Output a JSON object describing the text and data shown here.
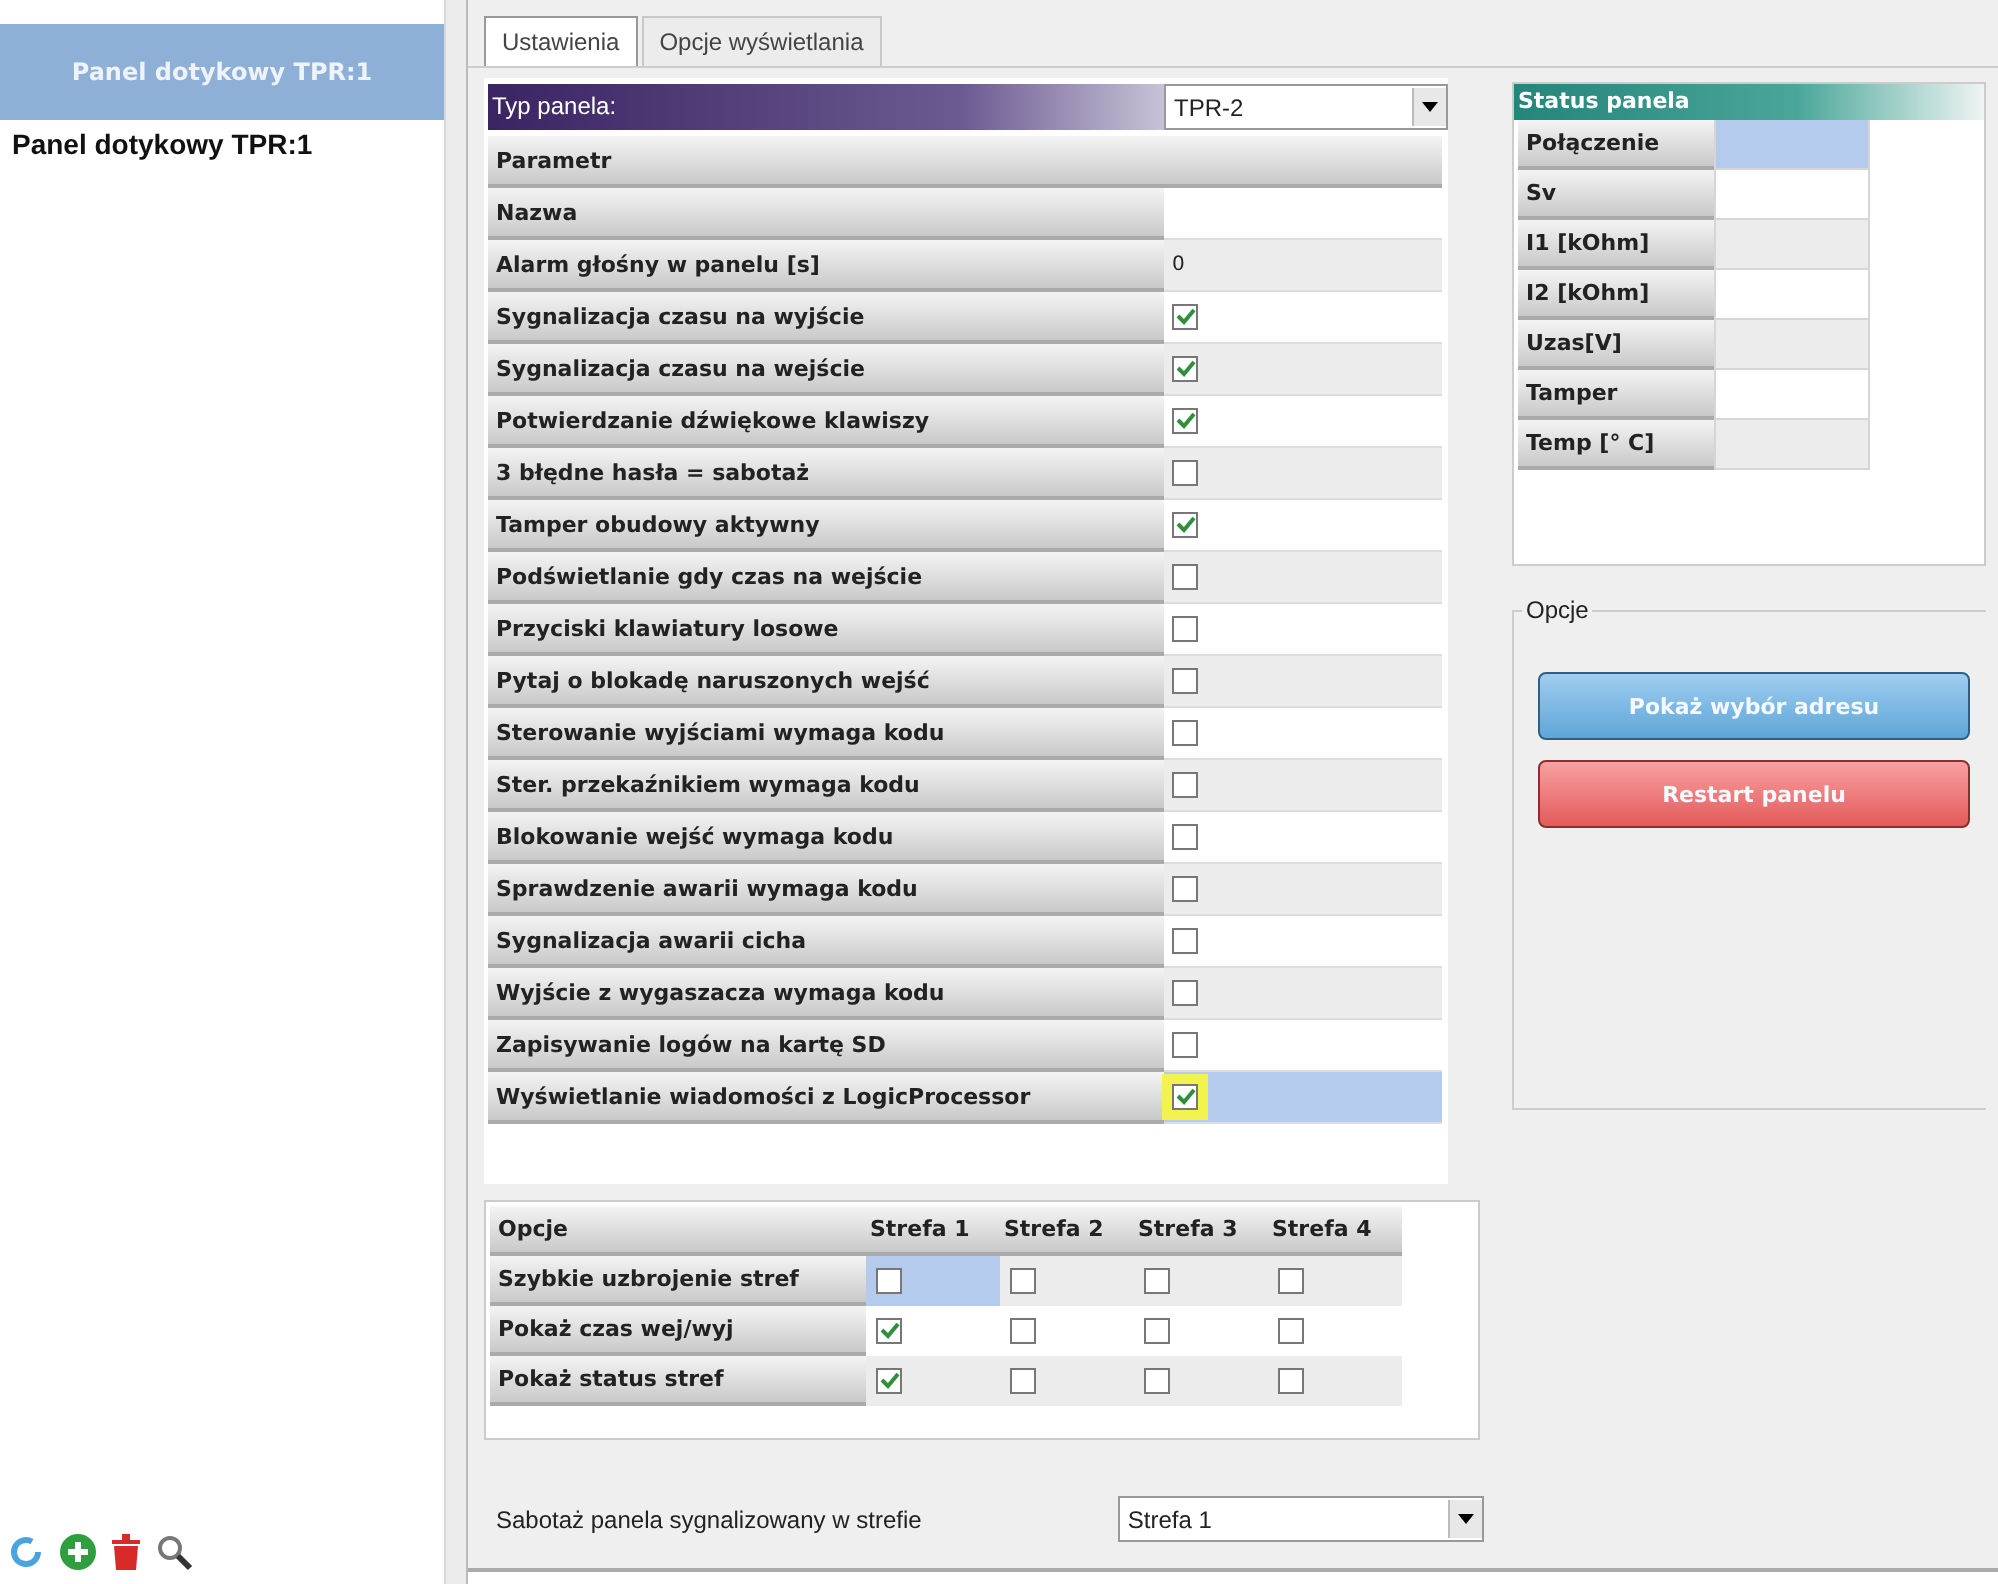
{
  "sidebar": {
    "header": "Panel dotykowy TPR:1",
    "items": [
      {
        "label": "Panel dotykowy TPR:1",
        "selected": false
      }
    ]
  },
  "tabs": [
    {
      "label": "Ustawienia",
      "selected": true
    },
    {
      "label": "Opcje wyświetlania",
      "selected": false
    }
  ],
  "panel_type": {
    "label": "Typ panela:",
    "value": "TPR-2"
  },
  "settings": {
    "columns": [
      "Parametr"
    ],
    "rows": [
      {
        "label": "Nazwa",
        "kind": "text",
        "value": "",
        "selected": false
      },
      {
        "label": "Alarm głośny w panelu [s]",
        "kind": "text",
        "value": "0",
        "selected": false
      },
      {
        "label": "Sygnalizacja czasu na wyjście",
        "kind": "checkbox",
        "checked": true,
        "selected": false
      },
      {
        "label": "Sygnalizacja czasu na wejście",
        "kind": "checkbox",
        "checked": true,
        "selected": false
      },
      {
        "label": "Potwierdzanie dźwiękowe klawiszy",
        "kind": "checkbox",
        "checked": true,
        "selected": false
      },
      {
        "label": "3 błędne hasła = sabotaż",
        "kind": "checkbox",
        "checked": false,
        "selected": false
      },
      {
        "label": "Tamper obudowy aktywny",
        "kind": "checkbox",
        "checked": true,
        "selected": false
      },
      {
        "label": "Podświetlanie gdy czas na wejście",
        "kind": "checkbox",
        "checked": false,
        "selected": false
      },
      {
        "label": "Przyciski klawiatury losowe",
        "kind": "checkbox",
        "checked": false,
        "selected": false
      },
      {
        "label": "Pytaj o blokadę naruszonych wejść",
        "kind": "checkbox",
        "checked": false,
        "selected": false
      },
      {
        "label": "Sterowanie wyjściami wymaga kodu",
        "kind": "checkbox",
        "checked": false,
        "selected": false
      },
      {
        "label": "Ster. przekaźnikiem wymaga kodu",
        "kind": "checkbox",
        "checked": false,
        "selected": false
      },
      {
        "label": "Blokowanie wejść wymaga kodu",
        "kind": "checkbox",
        "checked": false,
        "selected": false
      },
      {
        "label": "Sprawdzenie awarii wymaga kodu",
        "kind": "checkbox",
        "checked": false,
        "selected": false
      },
      {
        "label": "Sygnalizacja awarii cicha",
        "kind": "checkbox",
        "checked": false,
        "selected": false
      },
      {
        "label": "Wyjście z wygaszacza wymaga kodu",
        "kind": "checkbox",
        "checked": false,
        "selected": false
      },
      {
        "label": "Zapisywanie  logów na  kartę SD",
        "kind": "checkbox",
        "checked": false,
        "selected": false
      },
      {
        "label": "Wyświetlanie wiadomości z LogicProcessor",
        "kind": "checkbox",
        "checked": true,
        "selected": true
      }
    ]
  },
  "zones": {
    "columns": [
      "Opcje",
      "Strefa 1",
      "Strefa 2",
      "Strefa 3",
      "Strefa 4"
    ],
    "rows": [
      {
        "label": "Szybkie uzbrojenie stref",
        "cells": [
          {
            "checked": false,
            "selected": true
          },
          {
            "checked": false,
            "selected": false
          },
          {
            "checked": false,
            "selected": false
          },
          {
            "checked": false,
            "selected": false
          }
        ]
      },
      {
        "label": "Pokaż czas wej/wyj",
        "cells": [
          {
            "checked": true,
            "selected": false
          },
          {
            "checked": false,
            "selected": false
          },
          {
            "checked": false,
            "selected": false
          },
          {
            "checked": false,
            "selected": false
          }
        ]
      },
      {
        "label": "Pokaż status stref",
        "cells": [
          {
            "checked": true,
            "selected": false
          },
          {
            "checked": false,
            "selected": false
          },
          {
            "checked": false,
            "selected": false
          },
          {
            "checked": false,
            "selected": false
          }
        ]
      }
    ]
  },
  "tamper_zone": {
    "label": "Sabotaż panela sygnalizowany w strefie",
    "value": "Strefa 1"
  },
  "status": {
    "title": "Status panela",
    "rows": [
      {
        "label": "Połączenie",
        "selected": true
      },
      {
        "label": "Sv",
        "selected": false
      },
      {
        "label": "I1 [kOhm]",
        "selected": false
      },
      {
        "label": "I2 [kOhm]",
        "selected": false
      },
      {
        "label": "Uzas[V]",
        "selected": false
      },
      {
        "label": "Tamper",
        "selected": false
      },
      {
        "label": "Temp [° C]",
        "selected": false
      }
    ]
  },
  "options": {
    "title": "Opcje",
    "buttons": [
      {
        "label": "Pokaż wybór adresu",
        "kind": "primary"
      },
      {
        "label": "Restart  panelu",
        "kind": "danger"
      }
    ]
  }
}
